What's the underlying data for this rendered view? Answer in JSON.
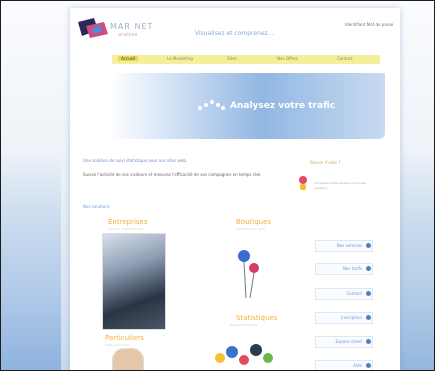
{
  "header": {
    "brand": "MAR NET",
    "brand_sub": "analyse",
    "slogan": "Visualisez et comprenez...",
    "login": "Identifiant\nMot de passe"
  },
  "nav": {
    "items": [
      "Accueil",
      "Le Marketing",
      "Sites",
      "Nos Offres",
      "Contact"
    ]
  },
  "banner": {
    "headline": "Analysez votre trafic"
  },
  "intro": {
    "text": "Une solution de suivi statistique pour vos sites web.",
    "description": "Suivez l'activité de vos visiteurs et mesurez l'efficacité de vos campagnes en temps réel.",
    "subheading": "Nos solutions"
  },
  "sidebar": {
    "title": "Besoin d'aide ?",
    "text": "Contactez notre équipe pour toute question."
  },
  "categories": [
    {
      "title": "Entreprises",
      "sub": "Pour les professionnels"
    },
    {
      "title": "Boutiques",
      "sub": "Commerce en ligne"
    },
    {
      "title": "Particuliers",
      "sub": "Sites personnels"
    },
    {
      "title": "Statistiques",
      "sub": "Rapports détaillés"
    }
  ],
  "actions": [
    "Nos services",
    "Nos tarifs",
    "Contact",
    "Inscription",
    "Espace client",
    "Aide"
  ],
  "colors": {
    "accent_blue": "#4d80c9",
    "nav_yellow": "#f3ef9a",
    "title_orange": "#f1b13a"
  }
}
